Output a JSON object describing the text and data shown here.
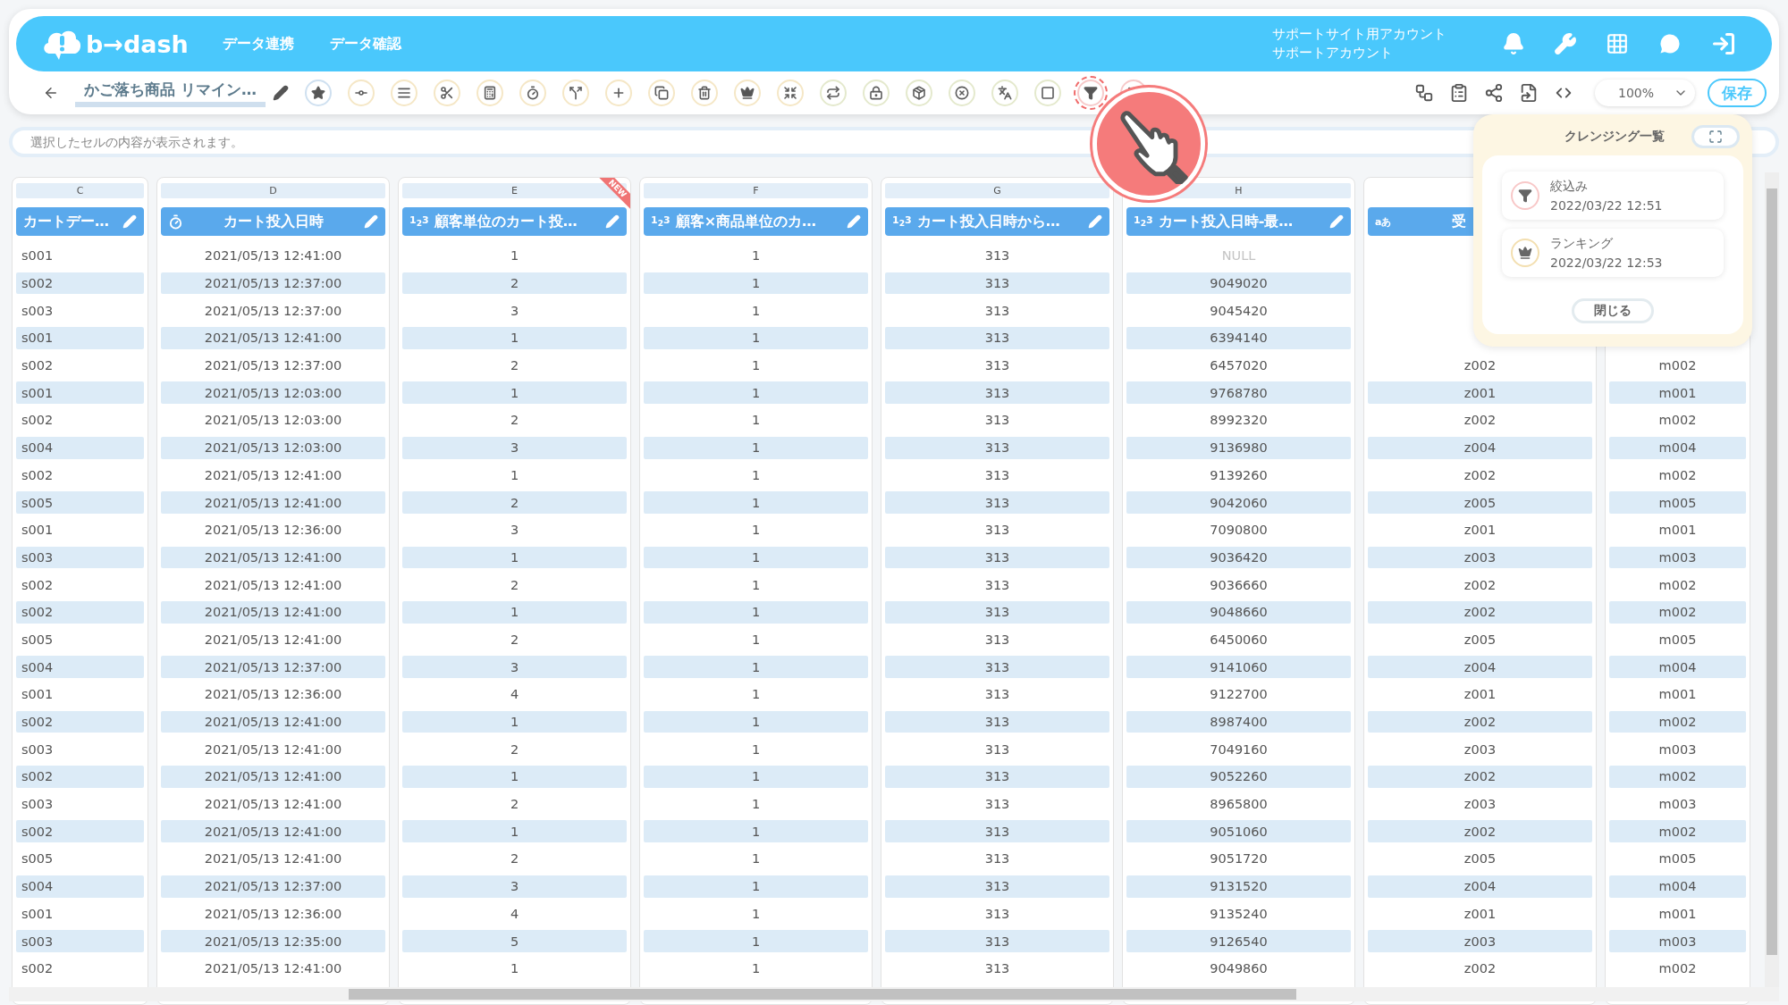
{
  "header": {
    "logo": "b→dash",
    "nav": [
      {
        "label": "データ連携"
      },
      {
        "label": "データ確認"
      }
    ],
    "account": [
      "サポートサイト用アカウント",
      "サポートアカウント"
    ]
  },
  "toolbar": {
    "title": "かご落ち商品 リマイン…",
    "tools": [
      {
        "kind": "star",
        "highlighted": false,
        "color": "#cfe0f0"
      },
      {
        "kind": "connect",
        "highlighted": false,
        "color": "#f5e7c6"
      },
      {
        "kind": "list",
        "highlighted": false,
        "color": "#f5e7c6"
      },
      {
        "kind": "tools",
        "highlighted": false,
        "color": "#f5e7c6"
      },
      {
        "kind": "calc",
        "highlighted": false,
        "color": "#f5e7c6"
      },
      {
        "kind": "timer",
        "highlighted": false,
        "color": "#f5e7c6"
      },
      {
        "kind": "split",
        "highlighted": false,
        "color": "#f5e7c6"
      },
      {
        "kind": "plus",
        "highlighted": false,
        "color": "#f5e7c6"
      },
      {
        "kind": "copy",
        "highlighted": false,
        "color": "#f5e7c6"
      },
      {
        "kind": "trash",
        "highlighted": false,
        "color": "#f5e7c6"
      },
      {
        "kind": "crown",
        "highlighted": false,
        "color": "#f5e7c6"
      },
      {
        "kind": "shrink",
        "highlighted": false,
        "color": "#f5e7c6"
      },
      {
        "kind": "repeat",
        "highlighted": false,
        "color": "#e4e9cd"
      },
      {
        "kind": "lock",
        "highlighted": false,
        "color": "#e4e9cd"
      },
      {
        "kind": "package",
        "highlighted": false,
        "color": "#e4e9cd"
      },
      {
        "kind": "remove",
        "highlighted": false,
        "color": "#e4e9cd"
      },
      {
        "kind": "translate",
        "highlighted": false,
        "color": "#e4e9cd"
      },
      {
        "kind": "zero",
        "highlighted": false,
        "color": "#e4e9cd"
      },
      {
        "kind": "filter",
        "highlighted": true,
        "color": "#f7caca"
      },
      {
        "kind": "group",
        "highlighted": false,
        "color": "#f7caca"
      }
    ],
    "zoom": "100%",
    "save": "保存"
  },
  "cell_view": {
    "placeholder": "選択したセルの内容が表示されます。"
  },
  "table": {
    "columns": [
      {
        "letter": "C",
        "label": "カートデー…"
      },
      {
        "letter": "D",
        "kind": "time",
        "label": "カート投入日時"
      },
      {
        "letter": "E",
        "kind": "number",
        "type_mark": "1$_{2}$3",
        "label": "顧客単位のカート投…",
        "new_badge": "NEW"
      },
      {
        "letter": "F",
        "kind": "number",
        "type_mark": "1$_{2}$3",
        "label": "顧客×商品単位のカ…"
      },
      {
        "letter": "G",
        "kind": "number",
        "type_mark": "1$_{2}$3",
        "label": "カート投入日時から…"
      },
      {
        "letter": "H",
        "kind": "number",
        "type_mark": "1$_{2}$3",
        "label": "カート投入日時-最…"
      },
      {
        "kind": "text",
        "type_mark": "aあ",
        "label": "受"
      },
      {}
    ],
    "rows": [
      [
        "s001",
        "2021/05/13 12:41:00",
        "1",
        "1",
        "313",
        {
          "text": "NULL",
          "is_null": true
        },
        null,
        null
      ],
      [
        "s002",
        "2021/05/13 12:37:00",
        "2",
        "1",
        "313",
        "9049020",
        null,
        null
      ],
      [
        "s003",
        "2021/05/13 12:37:00",
        "3",
        "1",
        "313",
        "9045420",
        null,
        null
      ],
      [
        "s001",
        "2021/05/13 12:41:00",
        "1",
        "1",
        "313",
        "6394140",
        null,
        null
      ],
      [
        "s002",
        "2021/05/13 12:37:00",
        "2",
        "1",
        "313",
        "6457020",
        "z002",
        "m002"
      ],
      [
        "s001",
        "2021/05/13 12:03:00",
        "1",
        "1",
        "313",
        "9768780",
        "z001",
        "m001"
      ],
      [
        "s002",
        "2021/05/13 12:03:00",
        "2",
        "1",
        "313",
        "8992320",
        "z002",
        "m002"
      ],
      [
        "s004",
        "2021/05/13 12:03:00",
        "3",
        "1",
        "313",
        "9136980",
        "z004",
        "m004"
      ],
      [
        "s002",
        "2021/05/13 12:41:00",
        "1",
        "1",
        "313",
        "9139260",
        "z002",
        "m002"
      ],
      [
        "s005",
        "2021/05/13 12:41:00",
        "2",
        "1",
        "313",
        "9042060",
        "z005",
        "m005"
      ],
      [
        "s001",
        "2021/05/13 12:36:00",
        "3",
        "1",
        "313",
        "7090800",
        "z001",
        "m001"
      ],
      [
        "s003",
        "2021/05/13 12:41:00",
        "1",
        "1",
        "313",
        "9036420",
        "z003",
        "m003"
      ],
      [
        "s002",
        "2021/05/13 12:41:00",
        "2",
        "1",
        "313",
        "9036660",
        "z002",
        "m002"
      ],
      [
        "s002",
        "2021/05/13 12:41:00",
        "1",
        "1",
        "313",
        "9048660",
        "z002",
        "m002"
      ],
      [
        "s005",
        "2021/05/13 12:41:00",
        "2",
        "1",
        "313",
        "6450060",
        "z005",
        "m005"
      ],
      [
        "s004",
        "2021/05/13 12:37:00",
        "3",
        "1",
        "313",
        "9141060",
        "z004",
        "m004"
      ],
      [
        "s001",
        "2021/05/13 12:36:00",
        "4",
        "1",
        "313",
        "9122700",
        "z001",
        "m001"
      ],
      [
        "s002",
        "2021/05/13 12:41:00",
        "1",
        "1",
        "313",
        "8987400",
        "z002",
        "m002"
      ],
      [
        "s003",
        "2021/05/13 12:41:00",
        "2",
        "1",
        "313",
        "7049160",
        "z003",
        "m003"
      ],
      [
        "s002",
        "2021/05/13 12:41:00",
        "1",
        "1",
        "313",
        "9052260",
        "z002",
        "m002"
      ],
      [
        "s003",
        "2021/05/13 12:41:00",
        "2",
        "1",
        "313",
        "8965800",
        "z003",
        "m003"
      ],
      [
        "s002",
        "2021/05/13 12:41:00",
        "1",
        "1",
        "313",
        "9051060",
        "z002",
        "m002"
      ],
      [
        "s005",
        "2021/05/13 12:41:00",
        "2",
        "1",
        "313",
        "9051720",
        "z005",
        "m005"
      ],
      [
        "s004",
        "2021/05/13 12:37:00",
        "3",
        "1",
        "313",
        "9131520",
        "z004",
        "m004"
      ],
      [
        "s001",
        "2021/05/13 12:36:00",
        "4",
        "1",
        "313",
        "9135240",
        "z001",
        "m001"
      ],
      [
        "s003",
        "2021/05/13 12:35:00",
        "5",
        "1",
        "313",
        "9126540",
        "z003",
        "m003"
      ],
      [
        "s002",
        "2021/05/13 12:41:00",
        "1",
        "1",
        "313",
        "9049860",
        "z002",
        "m002"
      ]
    ]
  },
  "cleansing_panel": {
    "title": "クレンジング一覧",
    "items": [
      {
        "kind": "filter",
        "name": "絞込み",
        "time": "2022/03/22 12:51"
      },
      {
        "kind": "ranking",
        "name": "ランキング",
        "time": "2022/03/22 12:53"
      }
    ],
    "close": "閉じる"
  }
}
